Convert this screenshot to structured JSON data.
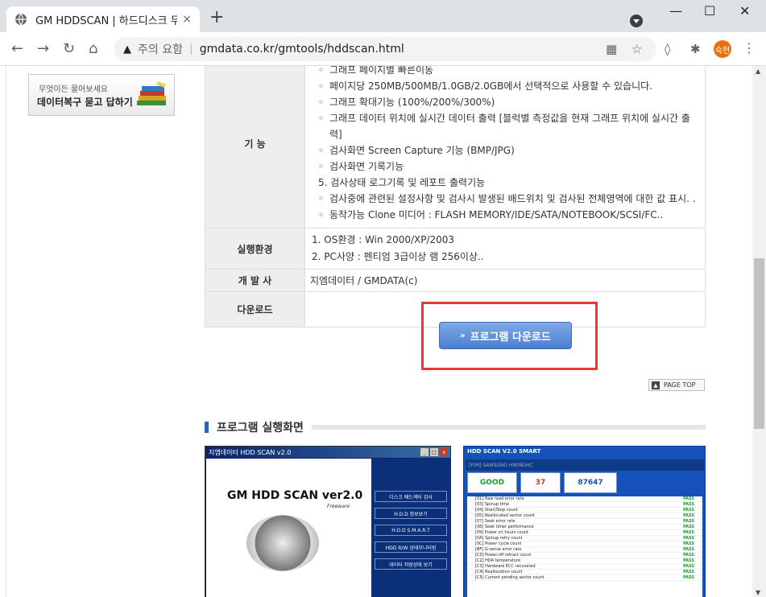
{
  "browser": {
    "tab_title": "GM HDDSCAN | 하드디스크 무료",
    "tab_close": "×",
    "new_tab": "+",
    "win_min": "—",
    "win_max": "☐",
    "win_close": "✕",
    "security_label": "주의 요함",
    "url": "gmdata.co.kr/gmtools/hddscan.html",
    "profile_initials": "숙현",
    "warn_glyph": "▲",
    "separator": "|"
  },
  "sidebar": {
    "banner_line1": "무엇이든 물어보세요",
    "banner_line2": "데이터복구 묻고 답하기"
  },
  "table": {
    "feature_header": "기 능",
    "feature_lines": [
      {
        "level": 2,
        "text": "그래프 페이지별 빠른이동"
      },
      {
        "level": 2,
        "text": "페이지당 250MB/500MB/1.0GB/2.0GB에서 선택적으로 사용할 수 있습니다."
      },
      {
        "level": 2,
        "text": "그래프 확대기능 (100%/200%/300%)"
      },
      {
        "level": 2,
        "text": "그래프 데이터 위치에 실시간 데이터 출력 [블럭별 측정값을 현재 그래프 위치에 실시간 출력]"
      },
      {
        "level": 2,
        "text": "검사화면 Screen Capture 기능 (BMP/JPG)"
      },
      {
        "level": 2,
        "text": "검사화면 기록기능"
      },
      {
        "level": 1,
        "text": "5. 검사상태 로그기록 및 레포트 출력기능"
      },
      {
        "level": 2,
        "text": "검사중에 관련된 설정사항 및 검사시 발생된 배드위치 및 검사된 전체영역에 대한 값 표시. ."
      },
      {
        "level": 2,
        "text": "동작가능 Clone 미디어 : FLASH MEMORY/IDE/SATA/NOTEBOOK/SCSI/FC.."
      }
    ],
    "env_header": "실행환경",
    "env_lines": [
      "1. OS환경 : Win 2000/XP/2003",
      "2. PC사양 : 펜티엄 3급이상 램 256이상.."
    ],
    "dev_header": "개 발 사",
    "dev_value": "지엠데이터 / GMDATA(c)",
    "download_header": "다운로드"
  },
  "download_button": {
    "arrow": "»",
    "label": "프로그램 다운로드"
  },
  "page_top": {
    "arrow": "▲",
    "label": "PAGE TOP"
  },
  "section": {
    "title": "프로그램 실행화면"
  },
  "screenshot1": {
    "titlebar": "지엠데이터 HDD SCAN v2.0",
    "win_min": "_",
    "win_max": "□",
    "win_close": "x",
    "headline": "GM HDD SCAN ver2.0",
    "sub": "Freeware",
    "menu": [
      "디스크 배드섹터 검사",
      "H.D.D 정보보기",
      "H.D.D S.M.A.R.T",
      "HDD R/W 상태모니터링",
      "데이터 저장상태 보기"
    ]
  },
  "screenshot2": {
    "title": "HDD SCAN V2.0 SMART",
    "model": "[P/M] SAMSUNG HM080HC",
    "g1": "GOOD",
    "g2": "37",
    "g3": "87647",
    "rows": [
      {
        "name": "[01] Raw read error rate",
        "status": "PASS"
      },
      {
        "name": "[03] Spinup time",
        "status": "PASS"
      },
      {
        "name": "[04] Start/Stop count",
        "status": "PASS"
      },
      {
        "name": "[05] Reallocated sector count",
        "status": "PASS"
      },
      {
        "name": "[07] Seek error rate",
        "status": "PASS"
      },
      {
        "name": "[08] Seek timer performance",
        "status": "PASS"
      },
      {
        "name": "[09] Power on hours count",
        "status": "PASS"
      },
      {
        "name": "[0A] Spinup retry count",
        "status": "PASS"
      },
      {
        "name": "[0C] Power cycle count",
        "status": "PASS"
      },
      {
        "name": "[BF] G-sense error rate",
        "status": "PASS"
      },
      {
        "name": "[C0] Power-off retract count",
        "status": "PASS"
      },
      {
        "name": "[C2] HDA temperature",
        "status": "PASS"
      },
      {
        "name": "[C3] Hardware ECC recovered",
        "status": "PASS"
      },
      {
        "name": "[C4] Reallocation count",
        "status": "PASS"
      },
      {
        "name": "[C5] Current pending sector count",
        "status": "PASS"
      }
    ]
  }
}
